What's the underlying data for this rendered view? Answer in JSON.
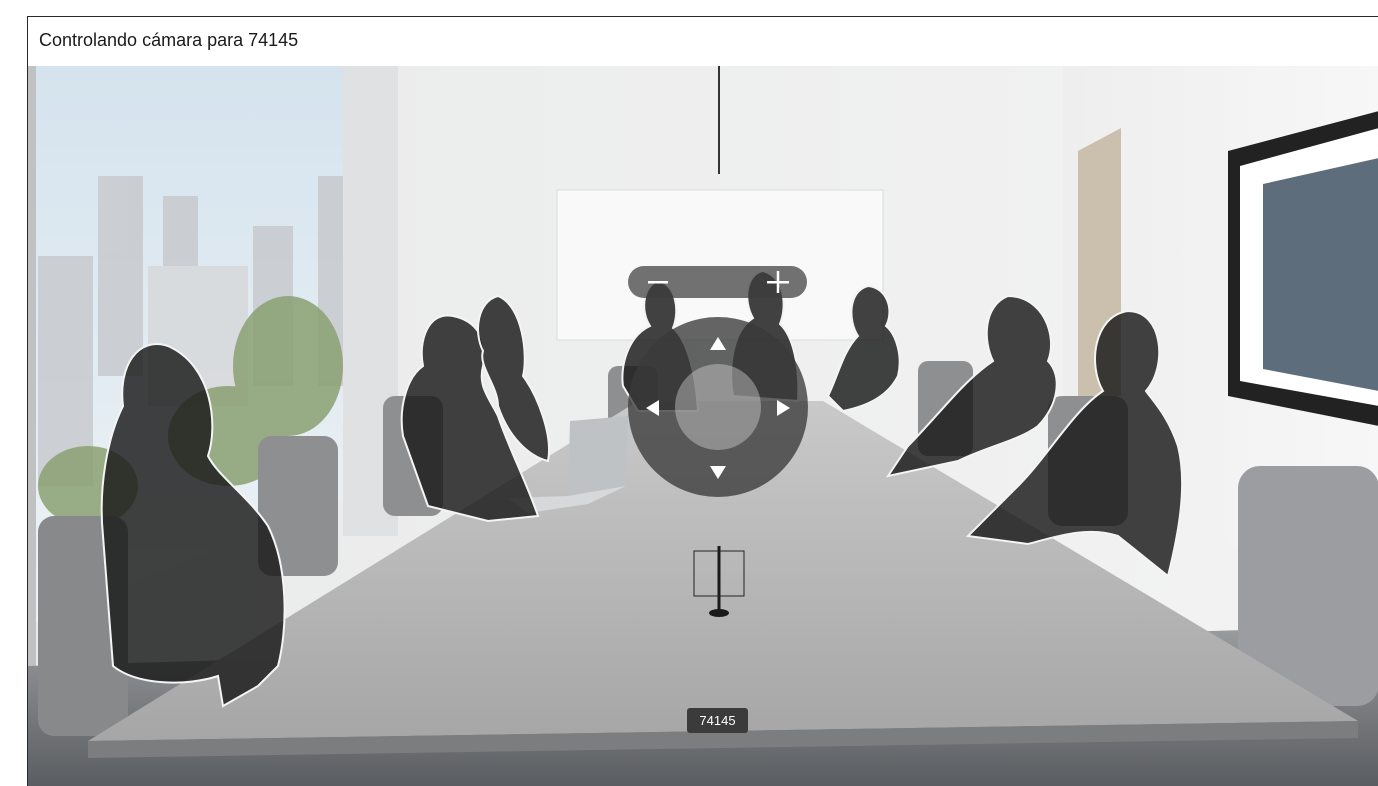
{
  "header": {
    "title": "Controlando cámara para 74145"
  },
  "camera_controls": {
    "zoom_out_icon": "minus-icon",
    "zoom_in_icon": "plus-icon",
    "pan_up_icon": "triangle-up-icon",
    "pan_down_icon": "triangle-down-icon",
    "pan_left_icon": "triangle-left-icon",
    "pan_right_icon": "triangle-right-icon"
  },
  "participant_label": "74145",
  "colors": {
    "header_bg": "#ffffff",
    "control_bg": "#3a3a3a",
    "label_bg": "#3b3b3b",
    "label_text": "#ffffff"
  }
}
